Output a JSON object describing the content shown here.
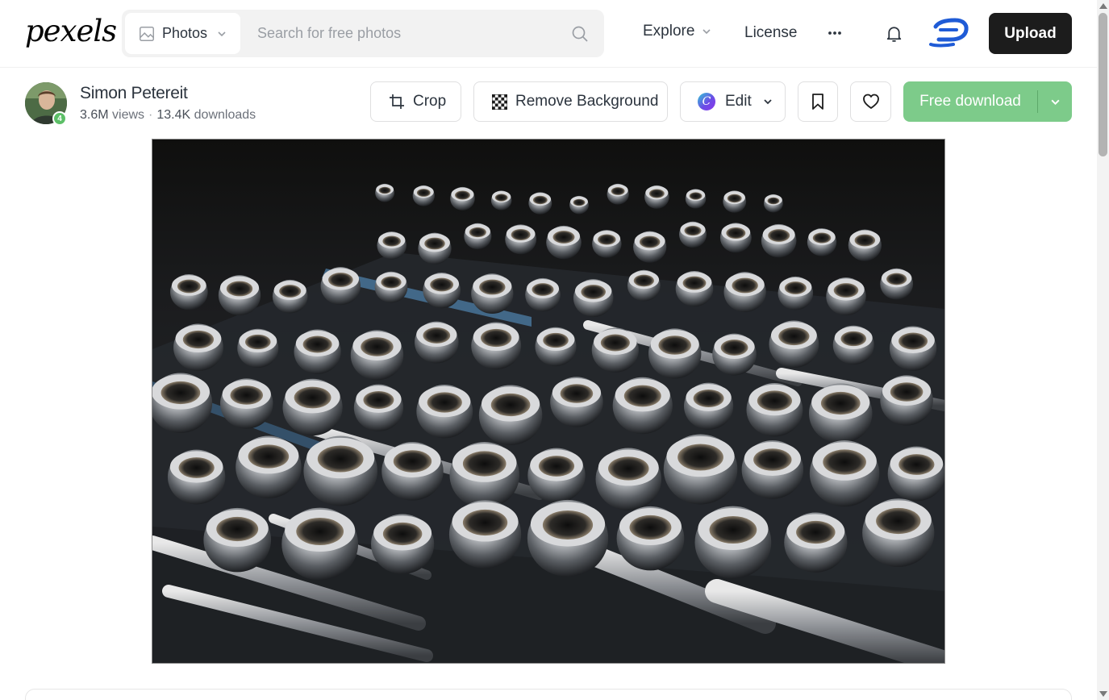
{
  "header": {
    "logo_text": "pexels",
    "search_type": "Photos",
    "search_placeholder": "Search for free photos",
    "nav_explore": "Explore",
    "nav_license": "License",
    "upload_label": "Upload"
  },
  "author": {
    "name": "Simon Petereit",
    "badge": "4",
    "views": "3.6M",
    "views_label": "views",
    "downloads": "13.4K",
    "downloads_label": "downloads"
  },
  "actions": {
    "crop": "Crop",
    "remove_background": "Remove Background",
    "edit": "Edit",
    "free_download": "Free download"
  },
  "photo": {
    "alt": "Close-up of a set of chrome sockets and ratchet wrenches in a dark tool case"
  },
  "colors": {
    "download_green": "#7dcb8a",
    "upload_black": "#1c1c1c",
    "search_bg": "#f2f2f2",
    "text": "#2c343e"
  },
  "icons": [
    "photo-icon",
    "chevron-down-icon",
    "search-icon",
    "more-dots-icon",
    "bell-icon",
    "crop-icon",
    "checkerboard-icon",
    "canva-icon",
    "bookmark-icon",
    "heart-icon"
  ]
}
